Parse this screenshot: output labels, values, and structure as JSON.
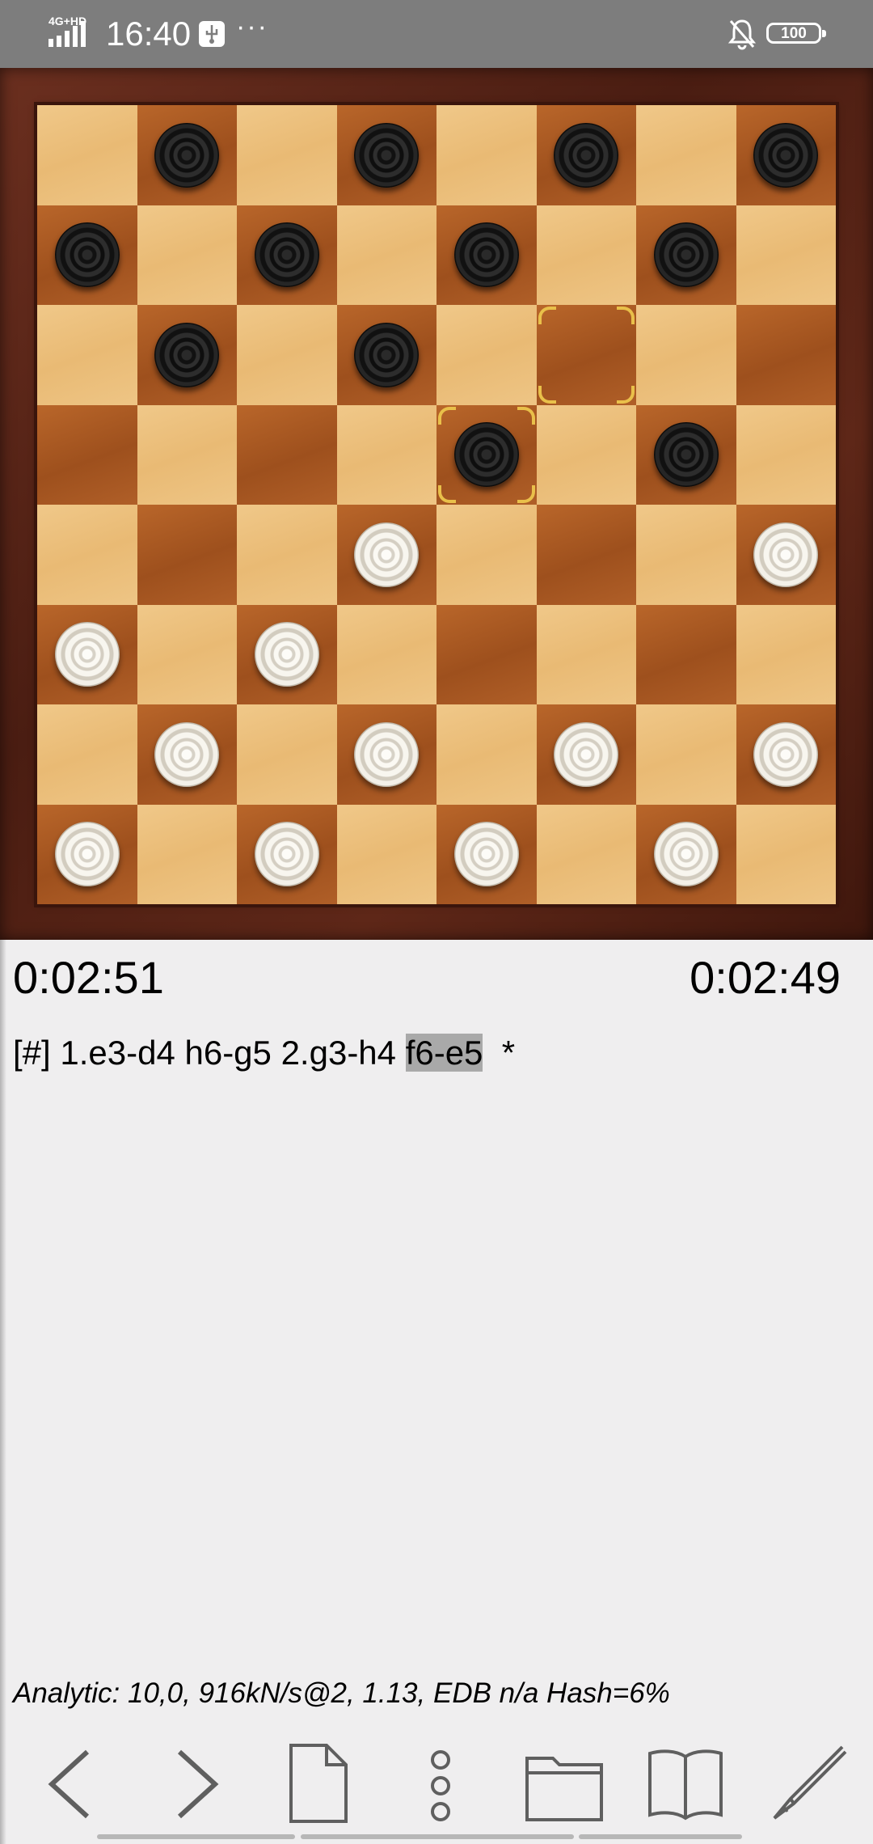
{
  "status_bar": {
    "network": "4G+HD",
    "time": "16:40",
    "more": "···",
    "battery": "100"
  },
  "board": {
    "black_pieces": [
      "b8",
      "d8",
      "f8",
      "h8",
      "a7",
      "c7",
      "e7",
      "g7",
      "b6",
      "d6",
      "e5",
      "g5"
    ],
    "white_pieces": [
      "d4",
      "h4",
      "a3",
      "c3",
      "b2",
      "d2",
      "f2",
      "h2",
      "a1",
      "c1",
      "e1",
      "g1"
    ],
    "highlight_squares": [
      "f6",
      "e5"
    ],
    "colors": {
      "light_square": "#eec585",
      "dark_square": "#a9561f",
      "frame": "#5a2416",
      "highlight": "#e9c04a"
    }
  },
  "clocks": {
    "left": "0:02:51",
    "right": "0:02:49"
  },
  "moves": {
    "prefix": "[#] 1.e3-d4 h6-g5 2.g3-h4 ",
    "current": "f6-e5",
    "suffix": "  *"
  },
  "analysis": "Analytic: 10,0, 916kN/s@2,  1.13,  EDB n/a Hash=6%",
  "toolbar": [
    {
      "name": "back-icon"
    },
    {
      "name": "forward-icon"
    },
    {
      "name": "new-game-icon"
    },
    {
      "name": "menu-dots-icon"
    },
    {
      "name": "folder-icon"
    },
    {
      "name": "book-icon"
    },
    {
      "name": "pencil-icon"
    }
  ]
}
